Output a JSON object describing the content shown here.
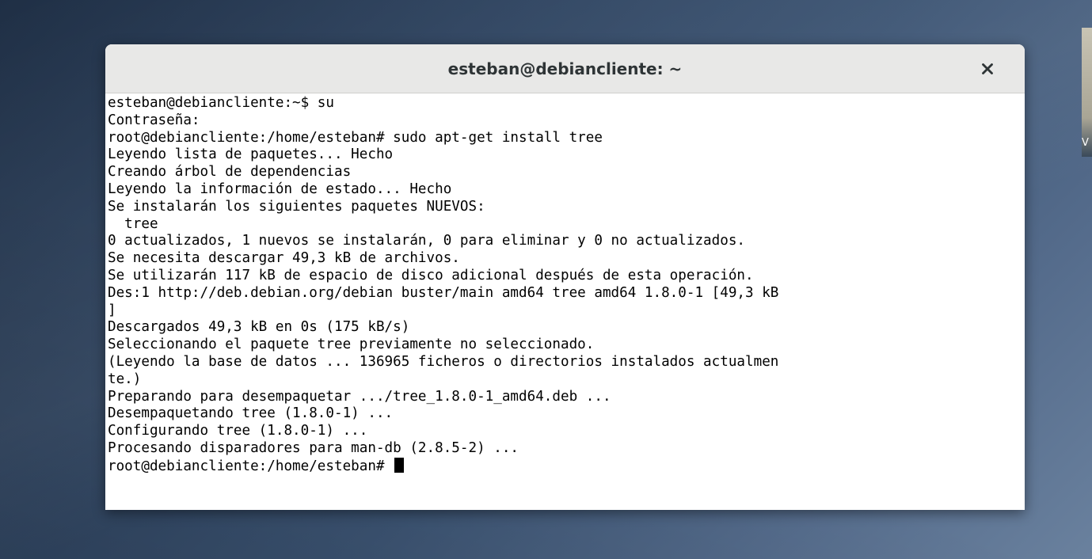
{
  "window": {
    "title": "esteban@debiancliente: ~",
    "close_icon": "close-icon"
  },
  "terminal": {
    "lines": [
      "esteban@debiancliente:~$ su",
      "Contraseña:",
      "root@debiancliente:/home/esteban# sudo apt-get install tree",
      "Leyendo lista de paquetes... Hecho",
      "Creando árbol de dependencias",
      "Leyendo la información de estado... Hecho",
      "Se instalarán los siguientes paquetes NUEVOS:",
      "  tree",
      "0 actualizados, 1 nuevos se instalarán, 0 para eliminar y 0 no actualizados.",
      "Se necesita descargar 49,3 kB de archivos.",
      "Se utilizarán 117 kB de espacio de disco adicional después de esta operación.",
      "Des:1 http://deb.debian.org/debian buster/main amd64 tree amd64 1.8.0-1 [49,3 kB",
      "]",
      "Descargados 49,3 kB en 0s (175 kB/s)",
      "Seleccionando el paquete tree previamente no seleccionado.",
      "(Leyendo la base de datos ... 136965 ficheros o directorios instalados actualmen",
      "te.)",
      "Preparando para desempaquetar .../tree_1.8.0-1_amd64.deb ...",
      "Desempaquetando tree (1.8.0-1) ...",
      "Configurando tree (1.8.0-1) ...",
      "Procesando disparadores para man-db (2.8.5-2) ..."
    ],
    "prompt": "root@debiancliente:/home/esteban# "
  },
  "side_thumbnail": {
    "label": "V"
  },
  "colors": {
    "terminal_bg": "#ffffff",
    "terminal_fg": "#000000",
    "titlebar_bg": "#e8e8e7"
  }
}
